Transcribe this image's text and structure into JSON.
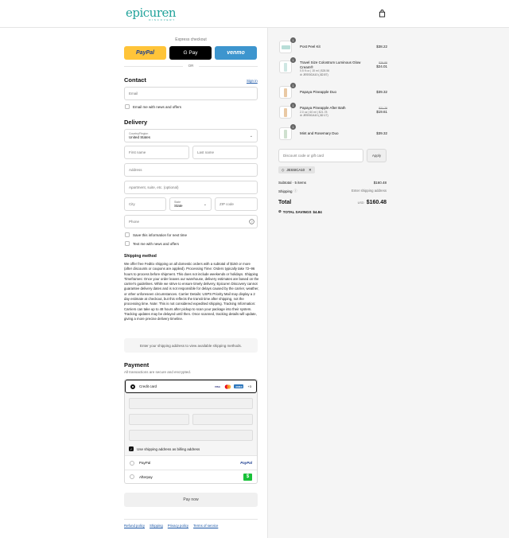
{
  "header": {
    "logo_text": "epicuren",
    "logo_sub": "DISCOVERY",
    "cart_icon": "shopping-bag-icon"
  },
  "express": {
    "label": "Express checkout",
    "buttons": {
      "paypal": "PayPal",
      "gpay": "G Pay",
      "venmo": "venmo"
    },
    "or": "OR"
  },
  "contact": {
    "heading": "Contact",
    "signin": "Sign in",
    "email_placeholder": "Email",
    "news_label": "Email me with news and offers"
  },
  "delivery": {
    "heading": "Delivery",
    "country_caption": "Country/Region",
    "country_value": "United States",
    "first_name": "First name",
    "last_name": "Last name",
    "address": "Address",
    "apartment": "Apartment, suite, etc. (optional)",
    "city": "City",
    "state_caption": "State",
    "state_value": "State",
    "zip": "ZIP code",
    "phone": "Phone",
    "save_info": "Save this information for next time",
    "text_me": "Text me with news and offers"
  },
  "shipping": {
    "heading": "Shipping method",
    "text": "We offer free FedEx shipping on all domestic orders with a subtotal of $150 or more (after discounts or coupons are applied). Processing Time: Orders typically take 72–96 hours to process before shipment. This does not include weekends or holidays. Shipping Timeframes: Once your order leaves our warehouse, delivery estimates are based on the carrier's guidelines. While we strive to ensure timely delivery, Epicuren Discovery cannot guarantee delivery dates and is not responsible for delays caused by the carrier, weather, or other unforeseen circumstances. Carrier Details: USPS Priority Mail may display a 2 day estimate at checkout, but this reflects the transit time after shipping, not the processing time. Note: This is not considered expedited shipping. Tracking Information: Carriers can take up to 48 hours after pickup to scan your package into their system. Tracking updates may be delayed until then. Once scanned, tracking details will update, giving a more precise delivery timeline.",
    "placeholder": "Enter your shipping address to view available shipping methods."
  },
  "payment": {
    "heading": "Payment",
    "sub": "All transactions are secure and encrypted.",
    "credit_card": "Credit card",
    "more_cards": "+3",
    "billing_same": "Use shipping address as billing address",
    "paypal": "PayPal",
    "afterpay": "Afterpay",
    "pay_now": "Pay now"
  },
  "footer": [
    "Refund policy",
    "Shipping",
    "Privacy policy",
    "Terms of service"
  ],
  "summary": {
    "items": [
      {
        "qty": "1",
        "name": "Post Peel Kit",
        "sub": "",
        "discount": "",
        "old": "",
        "price": "$38.22"
      },
      {
        "qty": "1",
        "name": "Travel Size Colostrum Luminous Glow Cream®",
        "sub": "0.5 fl oz | 15 ml | $28.56",
        "discount": "JESSICA10 (-$2.87)",
        "old": "$26.88",
        "price": "$24.01"
      },
      {
        "qty": "1",
        "name": "Papaya Pineapple Duo",
        "sub": "",
        "discount": "",
        "old": "",
        "price": "$39.32"
      },
      {
        "qty": "1",
        "name": "Papaya Pineapple After Bath",
        "sub": "2.0 oz | 60 ml | $21.78",
        "discount": "JESSICA10 (-$2.17)",
        "old": "$21.78",
        "price": "$19.61"
      },
      {
        "qty": "1",
        "name": "Mint and Rosemary Duo",
        "sub": "",
        "discount": "",
        "old": "",
        "price": "$39.32"
      }
    ],
    "discount_placeholder": "Discount code or gift card",
    "apply": "Apply",
    "code": "JESSICA10",
    "subtotal_label": "Subtotal · 5 items",
    "subtotal": "$160.48",
    "shipping_label": "Shipping",
    "shipping_value": "Enter shipping address",
    "total_label": "Total",
    "currency": "USD",
    "total": "$160.48",
    "savings_label": "TOTAL SAVINGS",
    "savings": "$4.84"
  }
}
